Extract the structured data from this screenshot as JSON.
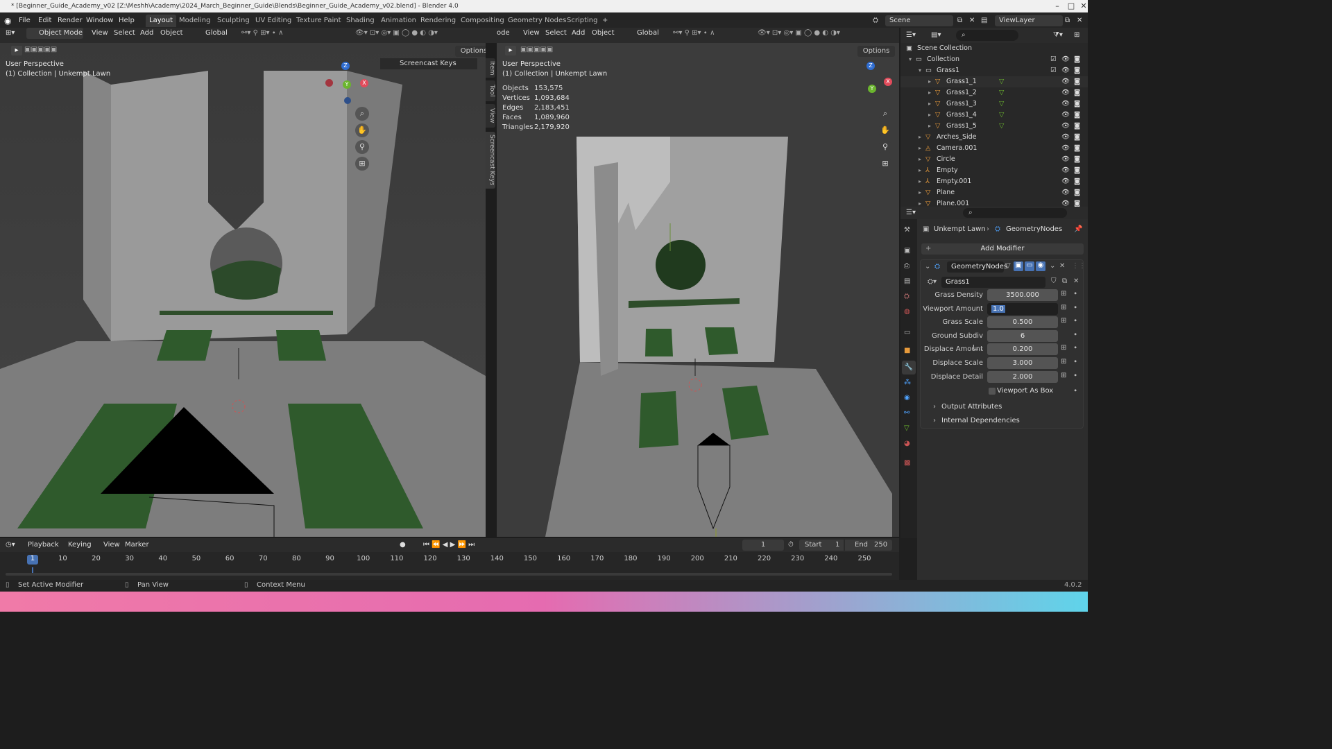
{
  "window": {
    "title": "* [Beginner_Guide_Academy_v02 [Z:\\Meshh\\Academy\\2024_March_Beginner_Guide\\Blends\\Beginner_Guide_Academy_v02.blend] - Blender 4.0",
    "min": "–",
    "max": "□",
    "close": "✕"
  },
  "menu": [
    "File",
    "Edit",
    "Render",
    "Window",
    "Help"
  ],
  "workspaces": [
    "Layout",
    "Modeling",
    "Sculpting",
    "UV Editing",
    "Texture Paint",
    "Shading",
    "Animation",
    "Rendering",
    "Compositing",
    "Geometry Nodes",
    "Scripting"
  ],
  "workspace_add": "+",
  "scene": {
    "label": "Scene",
    "viewlayer": "ViewLayer"
  },
  "left_header": {
    "mode": "Object Mode",
    "items": [
      "View",
      "Select",
      "Add",
      "Object"
    ],
    "orientation": "Global",
    "options": "Options"
  },
  "right_header": {
    "mode": "ode",
    "items": [
      "View",
      "Select",
      "Add",
      "Object"
    ],
    "orientation": "Global",
    "options": "Options"
  },
  "left_vp": {
    "perspective": "User Perspective",
    "collection": "(1) Collection | Unkempt Lawn",
    "screencast": "Screencast Keys",
    "side_tabs": [
      "Item",
      "Tool",
      "View",
      "Screencast Keys"
    ]
  },
  "right_vp": {
    "perspective": "User Perspective",
    "collection": "(1) Collection | Unkempt Lawn",
    "stats": [
      {
        "k": "Objects",
        "v": "153,575"
      },
      {
        "k": "Vertices",
        "v": "1,093,684"
      },
      {
        "k": "Edges",
        "v": "2,183,451"
      },
      {
        "k": "Faces",
        "v": "1,089,960"
      },
      {
        "k": "Triangles",
        "v": "2,179,920"
      }
    ]
  },
  "gizmo": {
    "z": "Z",
    "y": "Y",
    "x": "X"
  },
  "outliner": {
    "rows": [
      {
        "label": "Scene Collection",
        "depth": 0,
        "icon": "scene-collection-icon"
      },
      {
        "label": "Collection",
        "depth": 1,
        "icon": "collection-icon"
      },
      {
        "label": "Grass1",
        "depth": 2,
        "icon": "collection-icon"
      },
      {
        "label": "Grass1_1",
        "depth": 3,
        "icon": "mesh-icon"
      },
      {
        "label": "Grass1_2",
        "depth": 3,
        "icon": "mesh-icon"
      },
      {
        "label": "Grass1_3",
        "depth": 3,
        "icon": "mesh-icon"
      },
      {
        "label": "Grass1_4",
        "depth": 3,
        "icon": "mesh-icon"
      },
      {
        "label": "Grass1_5",
        "depth": 3,
        "icon": "mesh-icon"
      },
      {
        "label": "Arches_Side",
        "depth": 2,
        "icon": "mesh-icon"
      },
      {
        "label": "Camera.001",
        "depth": 2,
        "icon": "camera-icon"
      },
      {
        "label": "Circle",
        "depth": 2,
        "icon": "mesh-icon"
      },
      {
        "label": "Empty",
        "depth": 2,
        "icon": "empty-icon"
      },
      {
        "label": "Empty.001",
        "depth": 2,
        "icon": "empty-icon"
      },
      {
        "label": "Plane",
        "depth": 2,
        "icon": "mesh-icon"
      },
      {
        "label": "Plane.001",
        "depth": 2,
        "icon": "mesh-icon"
      }
    ]
  },
  "props": {
    "breadcrumb_obj": "Unkempt Lawn",
    "breadcrumb_mod": "GeometryNodes",
    "add_modifier": "Add Modifier",
    "modifier_name": "GeometryNodes",
    "node_group": "Grass1",
    "params": [
      {
        "label": "Grass Density",
        "value": "3500.000"
      },
      {
        "label": "Viewport Amount",
        "value": "1.0"
      },
      {
        "label": "Grass Scale",
        "value": "0.500"
      },
      {
        "label": "Ground Subdiv L...",
        "value": "6"
      },
      {
        "label": "Displace Amount",
        "value": "0.200"
      },
      {
        "label": "Displace Scale",
        "value": "3.000"
      },
      {
        "label": "Displace Detail",
        "value": "2.000"
      }
    ],
    "viewport_as_box": "Viewport As Box",
    "output_attributes": "Output Attributes",
    "internal_dependencies": "Internal Dependencies"
  },
  "timeline": {
    "menus": [
      "Playback",
      "Keying",
      "View",
      "Marker"
    ],
    "current": "1",
    "start_label": "Start",
    "start": "1",
    "end_label": "End",
    "end": "250",
    "ticks": [
      "1",
      "10",
      "20",
      "30",
      "40",
      "50",
      "60",
      "70",
      "80",
      "90",
      "100",
      "110",
      "120",
      "130",
      "140",
      "150",
      "160",
      "170",
      "180",
      "190",
      "200",
      "210",
      "220",
      "230",
      "240",
      "250"
    ]
  },
  "status": {
    "left": "Set Active Modifier",
    "mid": "Pan View",
    "right": "Context Menu",
    "version": "4.0.2"
  }
}
